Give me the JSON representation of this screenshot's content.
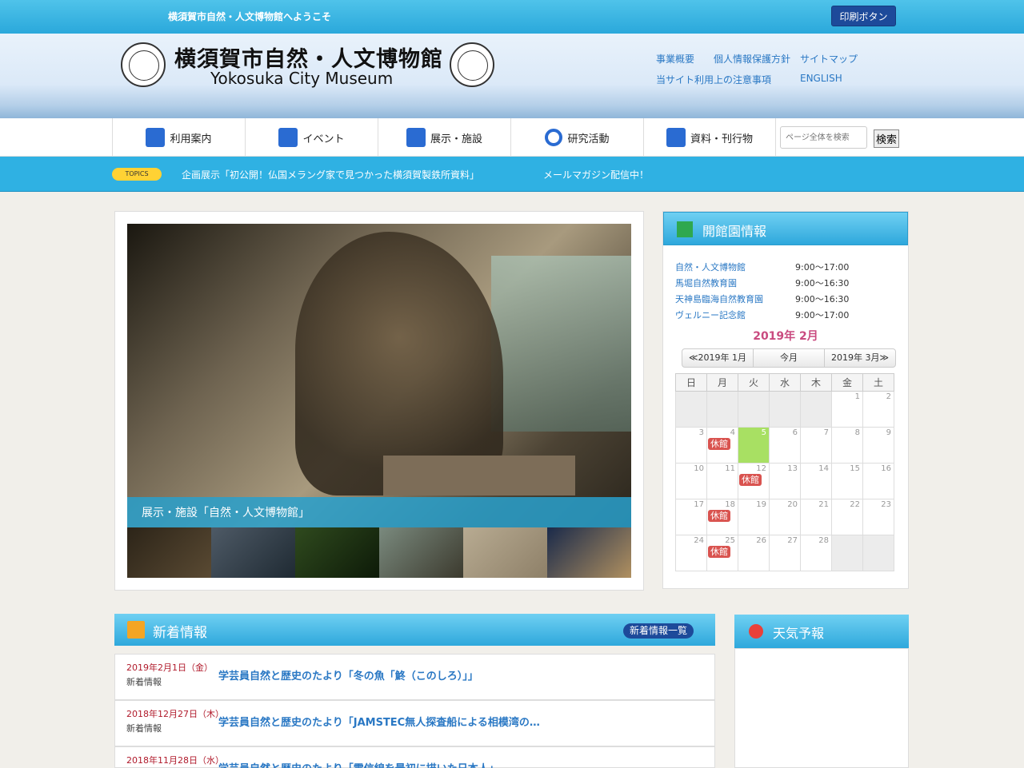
{
  "topbar": {
    "welcome": "横須賀市自然・人文博物館へようこそ",
    "print_label": "印刷ボタン"
  },
  "header": {
    "title": "横須賀市自然・人文博物館",
    "subtitle": "Yokosuka City Museum",
    "links": [
      "事業概要",
      "個人情報保護方針",
      "サイトマップ",
      "当サイト利用上の注意事項",
      "ENGLISH"
    ]
  },
  "nav": {
    "items": [
      {
        "label": "利用案内",
        "icon": "house-icon"
      },
      {
        "label": "イベント",
        "icon": "calendar-icon"
      },
      {
        "label": "展示・施設",
        "icon": "map-icon"
      },
      {
        "label": "研究活動",
        "icon": "magnifier-icon"
      },
      {
        "label": "資料・刊行物",
        "icon": "book-icon"
      }
    ],
    "search_placeholder": "ページ全体を検索",
    "search_button": "検索"
  },
  "topics": {
    "badge": "TOPICS",
    "item1": "企画展示「初公開！仏国メラング家で見つかった横須賀製鉄所資料」",
    "item2": "メールマガジン配信中！"
  },
  "slideshow": {
    "caption": "展示・施設「自然・人文博物館」"
  },
  "opening": {
    "heading": "開館園情報",
    "facilities": [
      {
        "name": "自然・人文博物館",
        "hours": "9:00〜17:00"
      },
      {
        "name": "馬堀自然教育園",
        "hours": "9:00〜16:30"
      },
      {
        "name": "天神島臨海自然教育園",
        "hours": "9:00〜16:30"
      },
      {
        "name": "ヴェルニー記念館",
        "hours": "9:00〜17:00"
      }
    ],
    "month": "2019年 2月",
    "prev": "≪2019年 1月",
    "today": "今月",
    "next": "2019年 3月≫",
    "weekdays": [
      "日",
      "月",
      "火",
      "水",
      "木",
      "金",
      "土"
    ],
    "closed_label": "休館"
  },
  "news": {
    "heading": "新着情報",
    "more": "新着情報一覧",
    "items": [
      {
        "date": "2019年2月1日（金）",
        "category": "新着情報",
        "title": "学芸員自然と歴史のたより「冬の魚「鮗（このしろ）」」"
      },
      {
        "date": "2018年12月27日（木）",
        "category": "新着情報",
        "title": "学芸員自然と歴史のたより「JAMSTEC無人探査船による相模湾の…"
      },
      {
        "date": "2018年11月28日（水）",
        "category": "",
        "title": "学芸員自然と歴史のたより「電信線を最初に描いた日本人」"
      }
    ]
  },
  "weather": {
    "heading": "天気予報"
  }
}
